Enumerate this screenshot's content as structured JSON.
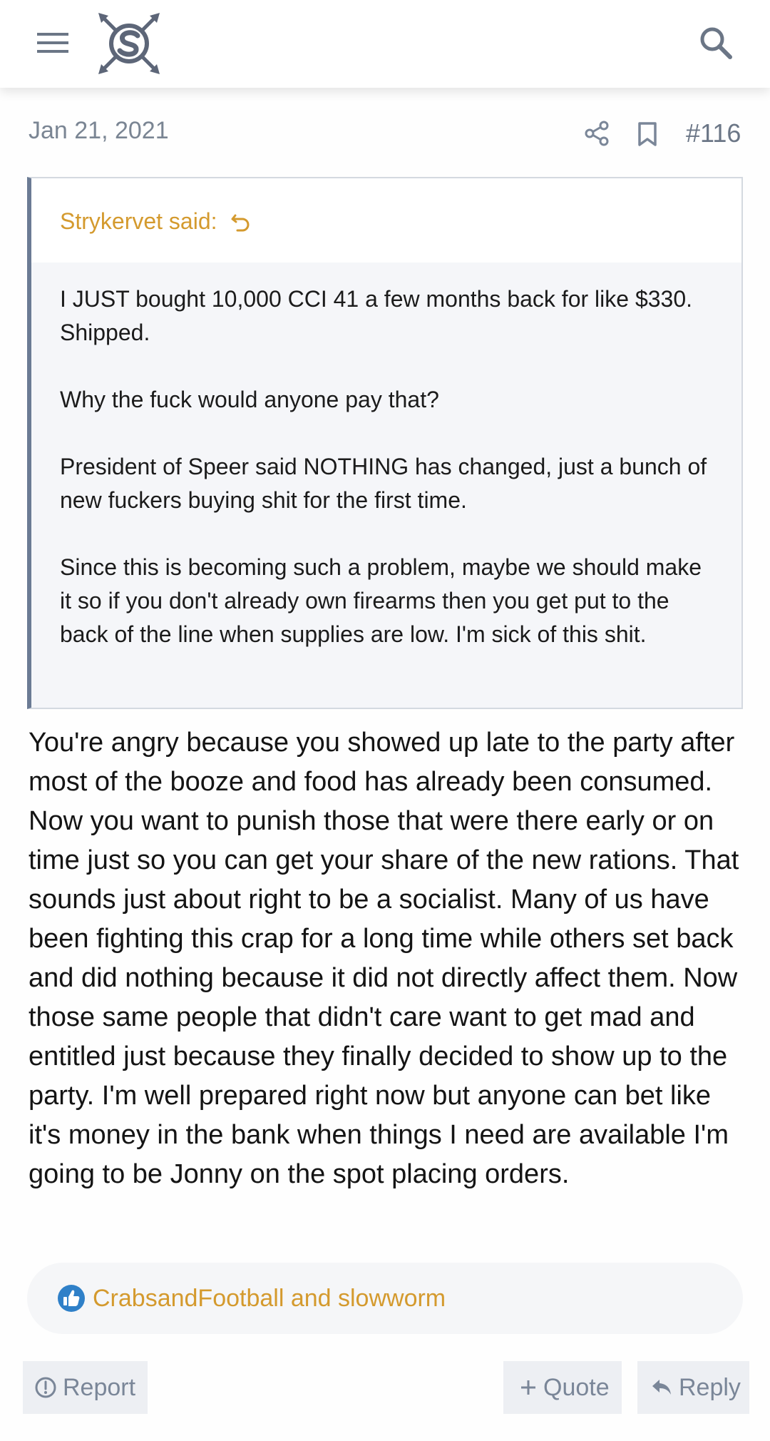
{
  "header": {
    "menu_icon": "hamburger-menu-icon",
    "logo_icon": "site-logo-icon",
    "search_icon": "search-icon"
  },
  "post": {
    "date": "Jan 21, 2021",
    "number": "#116",
    "quote": {
      "author": "Strykervet said:",
      "paragraphs": [
        "I JUST bought 10,000 CCI 41 a few months back for like $330. Shipped.",
        "Why the fuck would anyone pay that?",
        "President of Speer said NOTHING has changed, just a bunch of new fuckers buying shit for the first time.",
        "Since this is becoming such a problem, maybe we should make it so if you don't already own firearms then you get put to the back of the line when supplies are low. I'm sick of this shit."
      ]
    },
    "body": "You're angry because you showed up late to the party after most of the booze and food has already been consumed. Now you want to punish those that were there early or on time just so you can get your share of the new rations. That sounds just about right to be a socialist. Many of us have been fighting this crap for a long time while others set back and did nothing because it did not directly affect them. Now those same people that didn't care want to get mad and entitled just because they finally decided to show up to the party. I'm well prepared right now but anyone can bet like it's money in the bank when things I need are available I'm going to be Jonny on the spot placing orders.",
    "reactions": {
      "users": "CrabsandFootball and slowworm"
    },
    "actions": {
      "report": "Report",
      "quote": "Quote",
      "reply": "Reply"
    }
  },
  "colors": {
    "accent": "#d49a2e",
    "muted": "#7a8698",
    "quote_border": "#6b7b94",
    "like_blue": "#2f80c8"
  }
}
